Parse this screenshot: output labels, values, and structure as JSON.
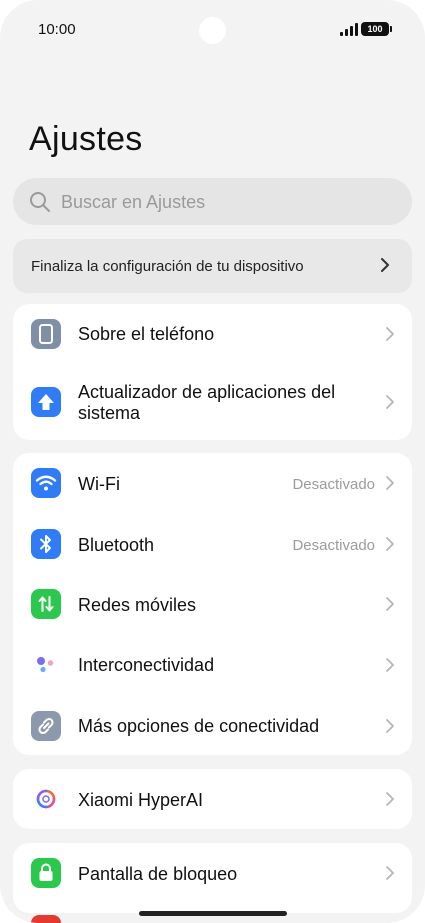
{
  "status": {
    "time": "10:00",
    "battery": "100"
  },
  "header": {
    "title": "Ajustes"
  },
  "search": {
    "placeholder": "Buscar en Ajustes"
  },
  "setup_banner": {
    "label": "Finaliza la configuración de tu dispositivo"
  },
  "groups": [
    {
      "items": [
        {
          "label": "Sobre el teléfono",
          "icon": "phone-icon"
        },
        {
          "label": "Actualizador de aplicaciones del sistema",
          "icon": "update-arrow-icon"
        }
      ]
    },
    {
      "items": [
        {
          "label": "Wi-Fi",
          "value": "Desactivado",
          "icon": "wifi-icon"
        },
        {
          "label": "Bluetooth",
          "value": "Desactivado",
          "icon": "bluetooth-icon"
        },
        {
          "label": "Redes móviles",
          "icon": "mobile-data-icon"
        },
        {
          "label": "Interconectividad",
          "icon": "interconnectivity-icon"
        },
        {
          "label": "Más opciones de conectividad",
          "icon": "link-icon"
        }
      ]
    },
    {
      "items": [
        {
          "label": "Xiaomi HyperAI",
          "icon": "hyperai-icon"
        }
      ]
    },
    {
      "items": [
        {
          "label": "Pantalla de bloqueo",
          "icon": "lock-icon"
        }
      ]
    }
  ],
  "colors": {
    "background": "#f3f3f3",
    "card": "#ffffff",
    "blue": "#2f7cf6",
    "green": "#2cc84d",
    "gray_icon": "#7f8fa6",
    "value_text": "#9b9b9b"
  }
}
